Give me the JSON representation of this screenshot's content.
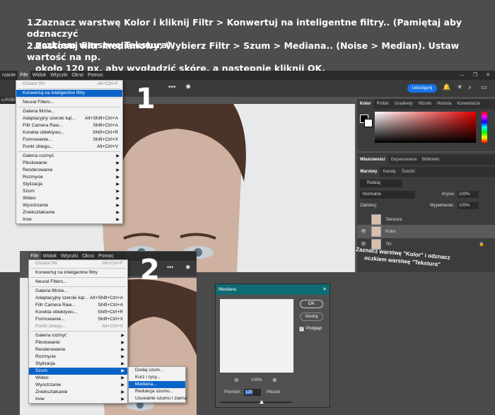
{
  "instructions": {
    "step1_num": "1.",
    "step1_line1": "Zaznacz warstwę Kolor i kliknij Filtr > Konwertuj na inteligentne filtry.. (Pamiętaj aby odznaczyć",
    "step1_line2": "oczkiem warstwę Tekstura)",
    "step2_num": "2.",
    "step2_line1": "Zastosuj filtr medianowy: Wybierz Filtr > Szum > Mediana.. (Noise > Median). Ustaw wartość na np.",
    "step2_line2": "około 120 px, aby wygładzić skórę, a następnie kliknij OK."
  },
  "ps1": {
    "menubar": [
      "rzanie",
      "Filtr",
      "Widok",
      "Wtyczki",
      "Okno",
      "Pomoc"
    ],
    "tab_label": "e,RGB/",
    "share_button": "Udostępnij",
    "big_number": "1",
    "filter_menu": {
      "last_filter": "Ostatni filtr",
      "last_filter_sc": "Alt+Ctrl+F",
      "convert_smart": "Konwertuj na inteligentne filtry",
      "neural": "Neural Filters...",
      "gallery": "Galeria filtrów...",
      "adaptive": "Adaptacyjny szeroki kąt...",
      "adaptive_sc": "Alt+Shift+Ctrl+A",
      "camera_raw": "Filtr Camera Raw...",
      "camera_raw_sc": "Shift+Ctrl+A",
      "lens": "Korekta obiektywu...",
      "lens_sc": "Shift+Ctrl+R",
      "liquify": "Formowanie...",
      "liquify_sc": "Shift+Ctrl+X",
      "vanishing": "Punkt zbiegu...",
      "vanishing_sc": "Alt+Ctrl+V",
      "blur": "Galeria rozmyć",
      "pixelate": "Pikslowanie",
      "render": "Renderowanie",
      "blur2": "Rozmycie",
      "stylize": "Stylizacja",
      "noise": "Szum",
      "video": "Wideo",
      "sharpen": "Wyostrzanie",
      "distort": "Zniekształcanie",
      "other": "Inne"
    },
    "panels": {
      "color_tabs": [
        "Kolor",
        "Próbki",
        "Gradienty",
        "Wzorki",
        "Historia",
        "Komentarze"
      ],
      "prop_tabs": [
        "Właściwości",
        "Dopasowania",
        "Biblioteki"
      ],
      "layer_tabs": [
        "Warstwy",
        "Kanały",
        "Ścieżki"
      ],
      "filter_kind": "Rodzaj",
      "blend_mode": "Normalne",
      "opacity_label": "Krycie:",
      "opacity_value": "100%",
      "lock_label": "Zablokuj:",
      "fill_label": "Wypełnienie:",
      "fill_value": "100%",
      "layers": [
        "Tekstura",
        "Kolor",
        "Tło"
      ]
    },
    "note": "Zaznacz warstwę \"Kolor\" i odznacz oczkiem warstwę \"Tekstura\""
  },
  "ps2": {
    "menubar": [
      "Filtr",
      "Widok",
      "Wtyczki",
      "Okno",
      "Pomoc"
    ],
    "big_number": "2",
    "filter_menu": {
      "last_filter": "Ostatni filtr",
      "last_filter_sc": "Alt+Ctrl+F",
      "convert_smart": "Konwertuj na inteligentne filtry",
      "neural": "Neural Filters...",
      "gallery": "Galeria filtrów...",
      "adaptive": "Adaptacyjny szeroki kąt...",
      "adaptive_sc": "Alt+Shift+Ctrl+A",
      "camera_raw": "Filtr Camera Raw...",
      "camera_raw_sc": "Shift+Ctrl+A",
      "lens": "Korekta obiektywu...",
      "lens_sc": "Shift+Ctrl+R",
      "liquify": "Formowanie...",
      "liquify_sc": "Shift+Ctrl+X",
      "vanishing": "Punkt zbiegu...",
      "vanishing_sc": "Alt+Ctrl+V",
      "blur": "Galeria rozmyć",
      "pixelate": "Pikslowanie",
      "render": "Renderowanie",
      "blur2": "Rozmycie",
      "stylize": "Stylizacja",
      "noise": "Szum",
      "video": "Wideo",
      "sharpen": "Wyostrzanie",
      "distort": "Zniekształcanie",
      "other": "Inne"
    },
    "noise_submenu": [
      "Dodaj szum...",
      "Kurz i rysy...",
      "Mediana...",
      "Redukcja szumu...",
      "Usuwanie szumu i ziarna"
    ],
    "median_dialog": {
      "title": "Mediana",
      "ok": "OK",
      "cancel": "Anuluj",
      "preview_label": "Podgląd",
      "zoom": "100%",
      "radius_label": "Promień:",
      "radius_value": "120",
      "radius_unit": "Piksele"
    }
  },
  "colors": {
    "accent": "#1473e6",
    "highlight": "#0a64c8",
    "dialog_title": "#0e6a73"
  }
}
